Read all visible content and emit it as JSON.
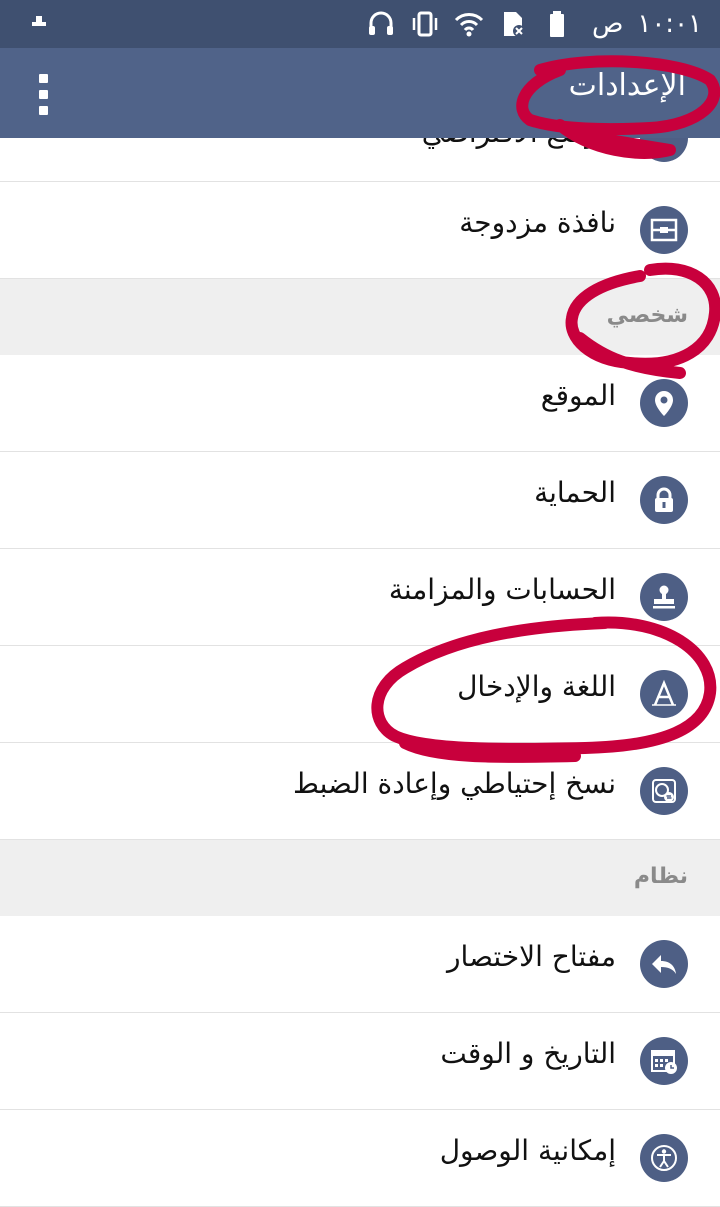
{
  "status_bar": {
    "time": "١٠:٠١",
    "ampm": "ص"
  },
  "app_bar": {
    "title": "الإعدادات",
    "menu_icon": "more-vert-icon"
  },
  "partial_item": {
    "label": "الوضع الافتراضي",
    "icon": "display-icon"
  },
  "items_top": [
    {
      "label": "نافذة مزدوجة",
      "icon": "dual-window-icon"
    }
  ],
  "section_personal": "شخصي",
  "items_personal": [
    {
      "label": "الموقع",
      "icon": "location-pin-icon"
    },
    {
      "label": "الحماية",
      "icon": "lock-icon"
    },
    {
      "label": "الحسابات والمزامنة",
      "icon": "stamp-icon"
    },
    {
      "label": "اللغة والإدخال",
      "icon": "letter-a-icon"
    },
    {
      "label": "نسخ إحتياطي وإعادة الضبط",
      "icon": "backup-icon"
    }
  ],
  "section_system": "نظام",
  "items_system": [
    {
      "label": "مفتاح الاختصار",
      "icon": "reply-arrow-icon"
    },
    {
      "label": "التاريخ و الوقت",
      "icon": "calendar-clock-icon"
    },
    {
      "label": "إمكانية الوصول",
      "icon": "accessibility-icon"
    }
  ],
  "colors": {
    "status_bar": "#3f5070",
    "app_bar": "#506389",
    "icon_circle": "#4e5f85",
    "section_bg": "#efefef",
    "annotation": "#c8003c"
  }
}
